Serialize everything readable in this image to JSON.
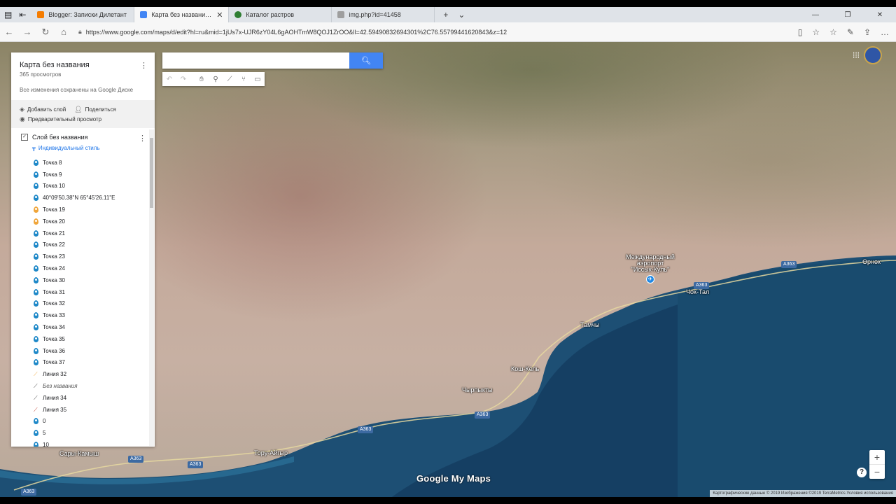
{
  "browser": {
    "tabs": [
      {
        "title": "Blogger: Записки Дилетант",
        "favicon_color": "#f57c00",
        "active": false
      },
      {
        "title": "Карта без названия (Gc",
        "favicon_color": "#4285f4",
        "active": true
      },
      {
        "title": "Каталог растров",
        "favicon_color": "#2e7d32",
        "active": false
      },
      {
        "title": "img.php?id=41458",
        "favicon_color": "#9e9e9e",
        "active": false
      }
    ],
    "url": "https://www.google.com/maps/d/edit?hl=ru&mid=1jUs7x-UJR6zY04L6gAOHTmW8QOJ1ZrOO&ll=42.59490832694301%2C76.55799441620843&z=12"
  },
  "search": {
    "placeholder": ""
  },
  "panel": {
    "title": "Карта без названия",
    "views": "365 просмотров",
    "saved": "Все изменения сохранены на Google Диске",
    "add_layer": "Добавить слой",
    "share": "Поделиться",
    "preview": "Предварительный просмотр",
    "layer_name": "Слой без названия",
    "layer_style": "Индивидуальный стиль",
    "items": [
      {
        "label": "Точка 8",
        "type": "pin",
        "color": "#1e88c8"
      },
      {
        "label": "Точка 9",
        "type": "pin",
        "color": "#1e88c8"
      },
      {
        "label": "Точка 10",
        "type": "pin",
        "color": "#1e88c8"
      },
      {
        "label": "40°09'50.38\"N 65°45'26.11\"E",
        "type": "pin",
        "color": "#1e88c8"
      },
      {
        "label": "Точка 19",
        "type": "pin",
        "color": "#f0a53a"
      },
      {
        "label": "Точка 20",
        "type": "pin",
        "color": "#f0a53a"
      },
      {
        "label": "Точка 21",
        "type": "pin",
        "color": "#1e88c8"
      },
      {
        "label": "Точка 22",
        "type": "pin",
        "color": "#1e88c8"
      },
      {
        "label": "Точка 23",
        "type": "pin",
        "color": "#1e88c8"
      },
      {
        "label": "Точка 24",
        "type": "pin",
        "color": "#1e88c8"
      },
      {
        "label": "Точка 30",
        "type": "pin",
        "color": "#1e88c8"
      },
      {
        "label": "Точка 31",
        "type": "pin",
        "color": "#1e88c8"
      },
      {
        "label": "Точка 32",
        "type": "pin",
        "color": "#1e88c8"
      },
      {
        "label": "Точка 33",
        "type": "pin",
        "color": "#1e88c8"
      },
      {
        "label": "Точка 34",
        "type": "pin",
        "color": "#1e88c8"
      },
      {
        "label": "Точка 35",
        "type": "pin",
        "color": "#1e88c8"
      },
      {
        "label": "Точка 36",
        "type": "pin",
        "color": "#1e88c8"
      },
      {
        "label": "Точка 37",
        "type": "pin",
        "color": "#1e88c8"
      },
      {
        "label": "Линия 32",
        "type": "line",
        "color": "#f0a53a"
      },
      {
        "label": "Без названия",
        "type": "line",
        "color": "#444444",
        "italic": true
      },
      {
        "label": "Линия 34",
        "type": "line",
        "color": "#444444"
      },
      {
        "label": "Линия 35",
        "type": "line",
        "color": "#c0392b"
      },
      {
        "label": "0",
        "type": "pin",
        "color": "#1e88c8"
      },
      {
        "label": "5",
        "type": "pin",
        "color": "#1e88c8"
      },
      {
        "label": "10",
        "type": "pin",
        "color": "#1e88c8"
      }
    ]
  },
  "map": {
    "places": {
      "airport": "Международный аэропорт \"Иссык-Куль\"",
      "chok_tal": "Чок-Тал",
      "tamchy": "Тамчы",
      "kosh_kol": "Кош-Кель",
      "chyrpykty": "Чырпыкты",
      "toru_aigyr": "Тору-Айгыр",
      "sary_kamysh": "Сары-Камыш",
      "orenek": "Өрнөк"
    },
    "road_name": "A363",
    "watermark": "Google My Maps",
    "copyright": "Картографические данные © 2019 Изображения ©2019 TerraMetrics   Условия использования"
  }
}
